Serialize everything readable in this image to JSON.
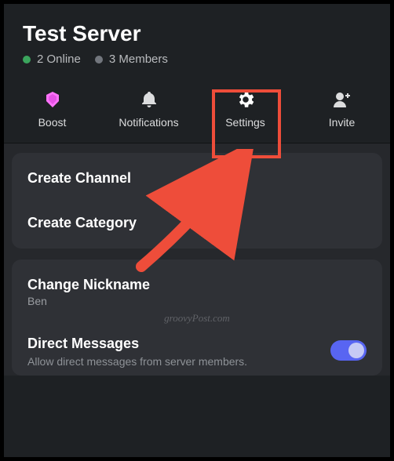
{
  "server": {
    "title": "Test Server",
    "online_count": "2 Online",
    "members_count": "3 Members"
  },
  "actions": {
    "boost": "Boost",
    "notifications": "Notifications",
    "settings": "Settings",
    "invite": "Invite"
  },
  "menu": {
    "create_channel": "Create Channel",
    "create_category": "Create Category",
    "change_nickname": "Change Nickname",
    "nickname_value": "Ben",
    "direct_messages_title": "Direct Messages",
    "direct_messages_desc": "Allow direct messages from server members."
  },
  "watermark": "groovyPost.com",
  "colors": {
    "highlight": "#ee4d3a",
    "toggle_on": "#5865f2"
  }
}
